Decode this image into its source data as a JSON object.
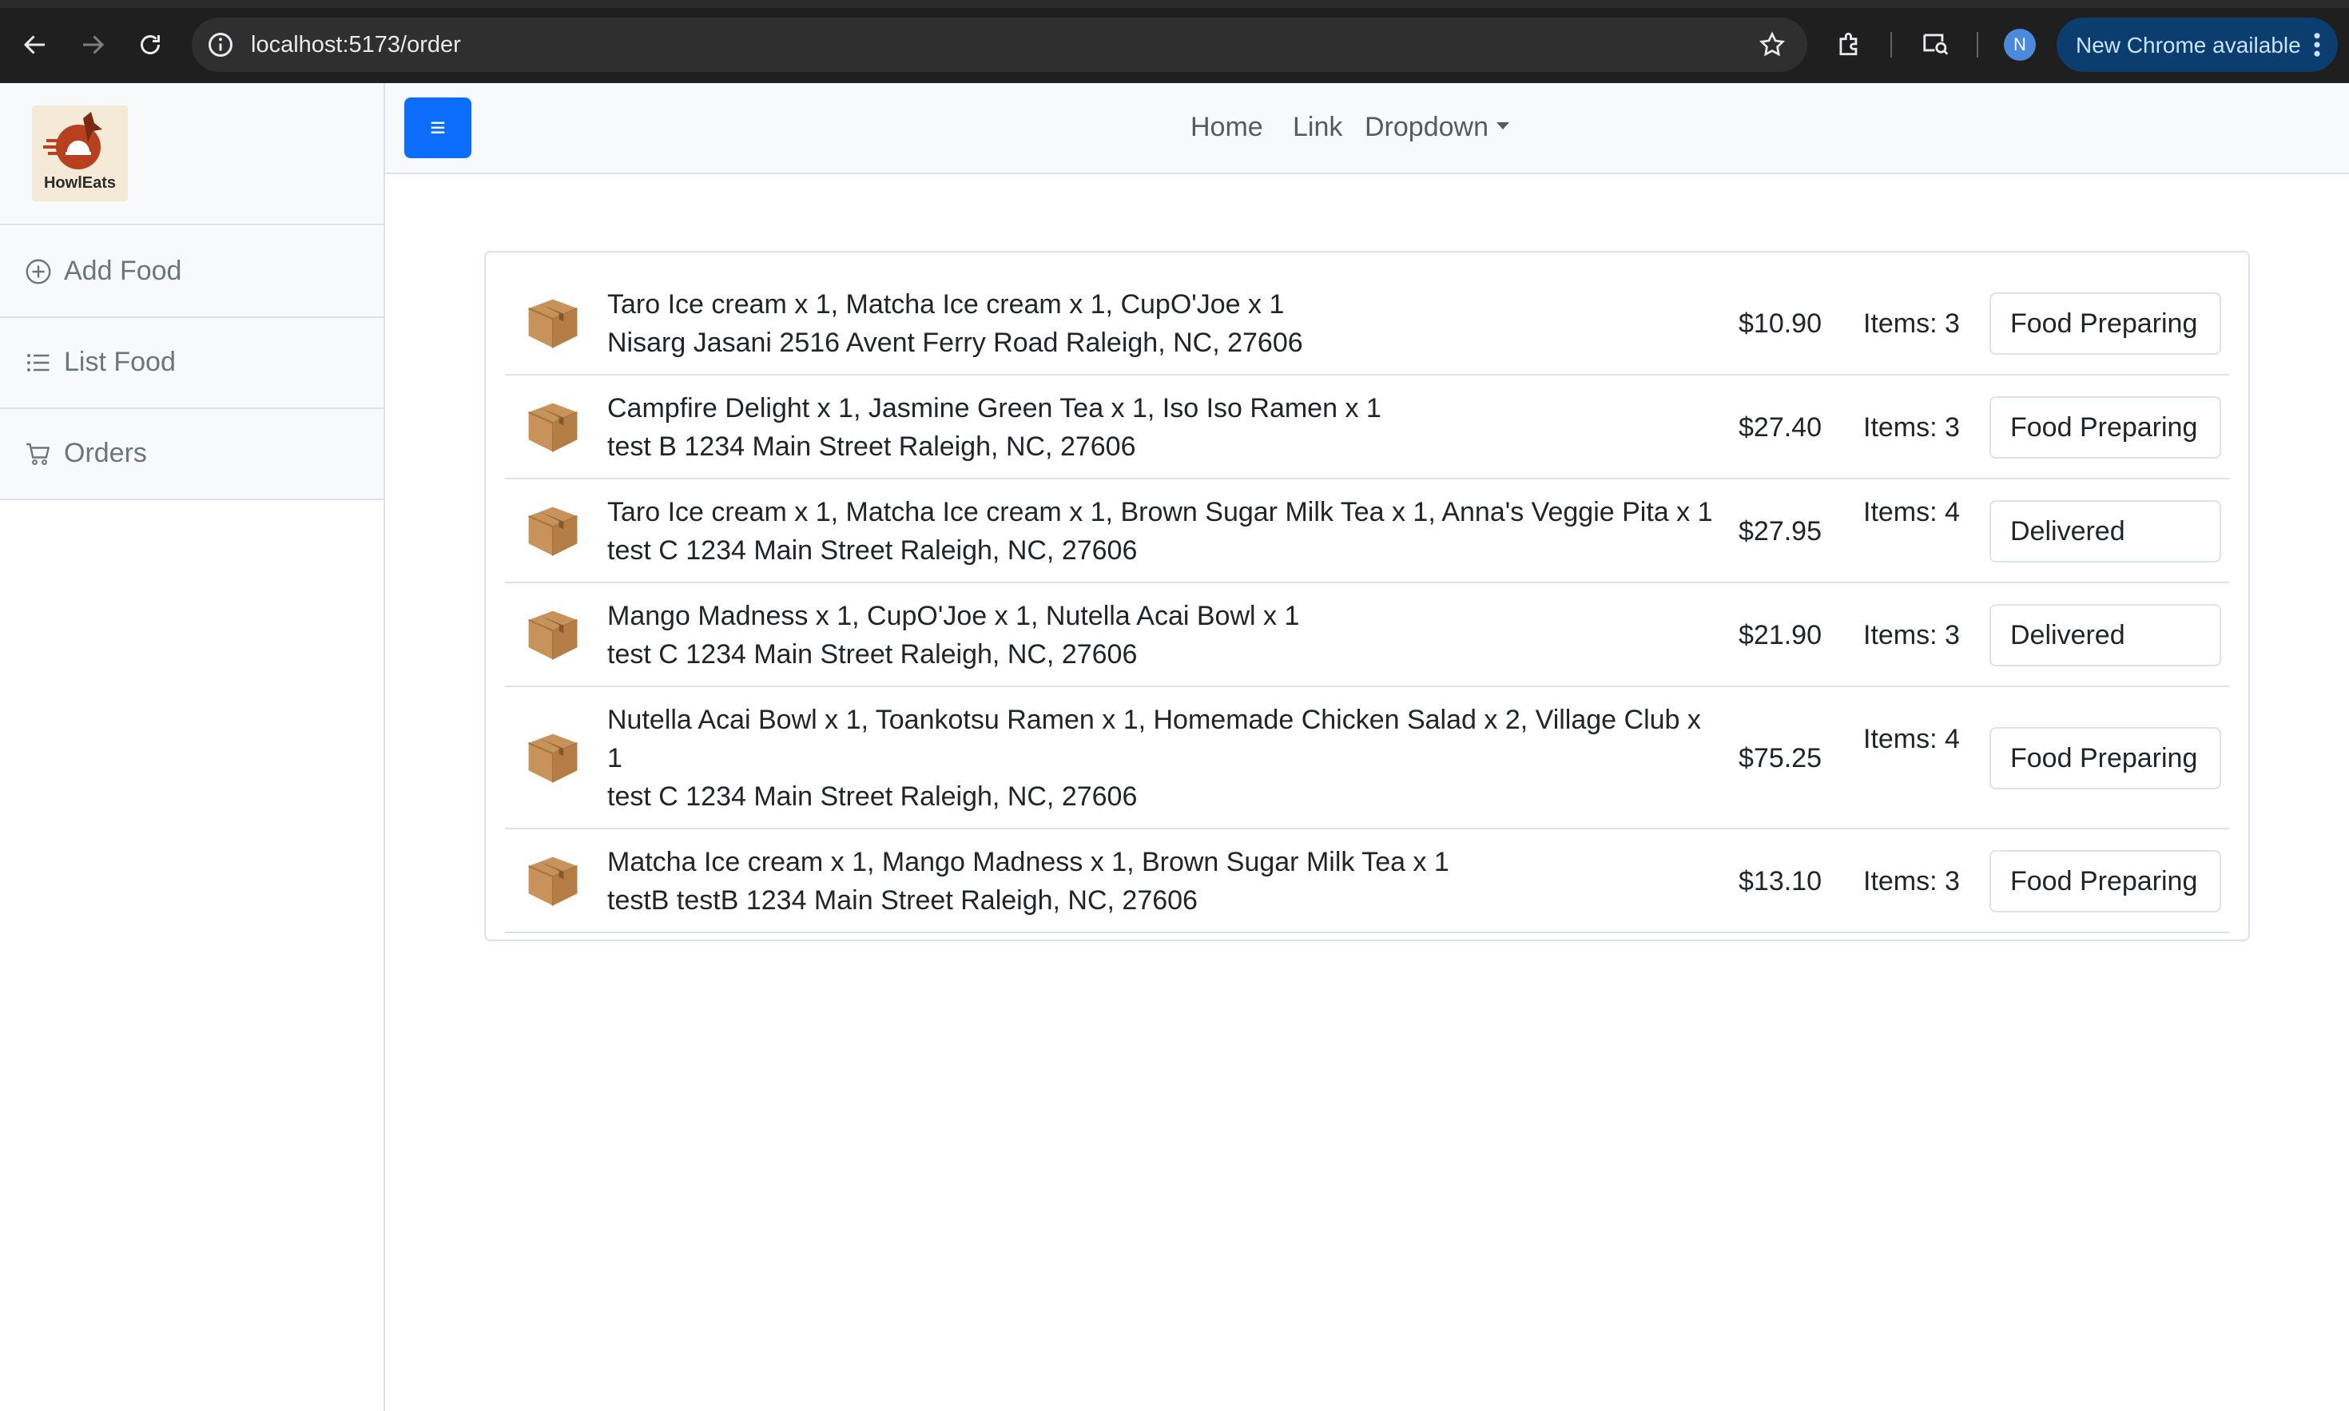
{
  "browser": {
    "url": "localhost:5173/order",
    "profile_initial": "N",
    "update_label": "New Chrome available",
    "icons": [
      "back-arrow-icon",
      "forward-arrow-icon",
      "reload-icon",
      "site-info-icon",
      "bookmark-star-icon",
      "extensions-icon",
      "lens-search-icon",
      "more-vertical-icon"
    ]
  },
  "brand": {
    "name": "HowlEats"
  },
  "sidebar": {
    "items": [
      {
        "label": "Add Food",
        "icon": "add-circle-icon"
      },
      {
        "label": "List Food",
        "icon": "list-icon"
      },
      {
        "label": "Orders",
        "icon": "cart-icon"
      }
    ]
  },
  "navbar": {
    "toggle_icon": "hamburger-icon",
    "links": [
      "Home",
      "Link",
      "Dropdown"
    ]
  },
  "orders": [
    {
      "items": "Taro Ice cream x 1, Matcha Ice cream x 1, CupO'Joe x 1",
      "address": "Nisarg Jasani 2516 Avent Ferry Road Raleigh, NC, 27606",
      "price": "$10.90",
      "count": "Items: 3",
      "status": "Food Preparing"
    },
    {
      "items": "Campfire Delight x 1, Jasmine Green Tea x 1, Iso Iso Ramen x 1",
      "address": "test B 1234 Main Street Raleigh, NC, 27606",
      "price": "$27.40",
      "count": "Items: 3",
      "status": "Food Preparing"
    },
    {
      "items": "Taro Ice cream x 1, Matcha Ice cream x 1, Brown Sugar Milk Tea x 1, Anna's Veggie Pita x 1",
      "address": "test C 1234 Main Street Raleigh, NC, 27606",
      "price": "$27.95",
      "count": "Items: 4",
      "status": "Delivered"
    },
    {
      "items": "Mango Madness x 1, CupO'Joe x 1, Nutella Acai Bowl x 1",
      "address": "test C 1234 Main Street Raleigh, NC, 27606",
      "price": "$21.90",
      "count": "Items: 3",
      "status": "Delivered"
    },
    {
      "items": "Nutella Acai Bowl x 1, Toankotsu Ramen x 1, Homemade Chicken Salad x 2, Village Club x 1",
      "address": "test C 1234 Main Street Raleigh, NC, 27606",
      "price": "$75.25",
      "count": "Items: 4",
      "status": "Food Preparing"
    },
    {
      "items": "Matcha Ice cream x 1, Mango Madness x 1, Brown Sugar Milk Tea x 1",
      "address": "testB testB 1234 Main Street Raleigh, NC, 27606",
      "price": "$13.10",
      "count": "Items: 3",
      "status": "Food Preparing"
    }
  ],
  "colors": {
    "primary": "#0d6efd",
    "navbar_bg": "#f8f9fa",
    "border": "#dee2e6",
    "muted_text": "#6c757d",
    "chrome_bg": "#1f1f1f"
  }
}
